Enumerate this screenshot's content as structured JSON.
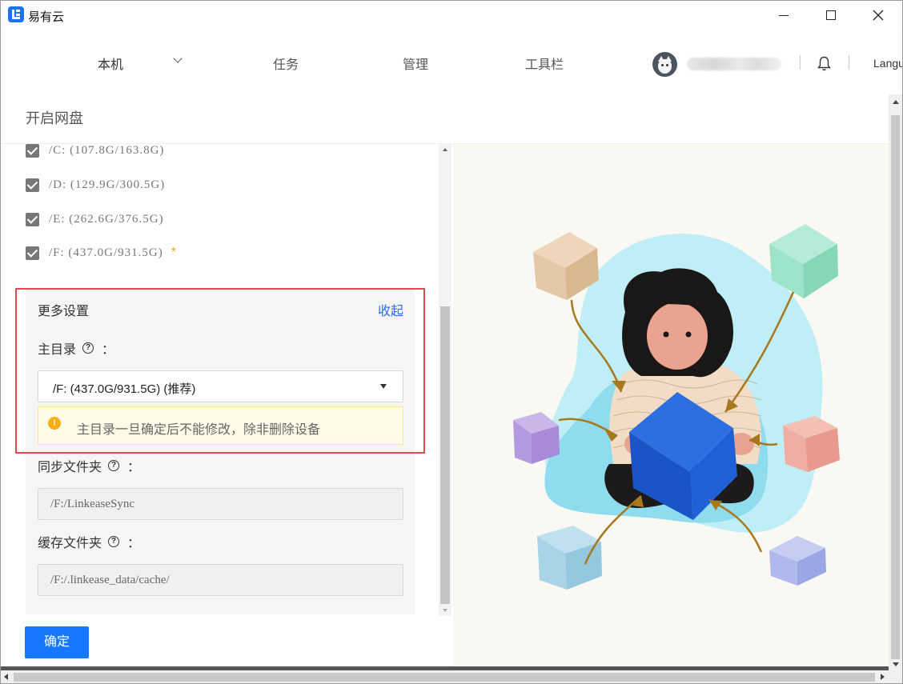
{
  "window": {
    "title": "易有云"
  },
  "nav": {
    "local": "本机",
    "task": "任务",
    "manage": "管理",
    "tools": "工具栏",
    "language": "Langu"
  },
  "page": {
    "title": "开启网盘"
  },
  "drives": [
    {
      "label": "/C: (107.8G/163.8G)",
      "checked": true,
      "recommended": false
    },
    {
      "label": "/D: (129.9G/300.5G)",
      "checked": true,
      "recommended": false
    },
    {
      "label": "/E: (262.6G/376.5G)",
      "checked": true,
      "recommended": false
    },
    {
      "label": "/F: (437.0G/931.5G)",
      "checked": true,
      "recommended": true,
      "mark": "*"
    }
  ],
  "more_settings": {
    "title": "更多设置",
    "collapse": "收起",
    "home_dir": {
      "label": "主目录",
      "colon": "：",
      "selected": "/F: (437.0G/931.5G) (推荐)",
      "warning": "主目录一旦确定后不能修改，除非删除设备"
    },
    "sync_folder": {
      "label": "同步文件夹",
      "colon": "：",
      "value": "/F:/LinkeaseSync"
    },
    "cache_folder": {
      "label": "缓存文件夹",
      "colon": "：",
      "value": "/F:/.linkease_data/cache/"
    }
  },
  "confirm": "确定",
  "colors": {
    "primary": "#1677ff",
    "link": "#2d6fe0",
    "highlight": "#e04b4b",
    "warning_bg": "#fffbe6"
  },
  "icons": {
    "help": "?",
    "warning": "!"
  }
}
